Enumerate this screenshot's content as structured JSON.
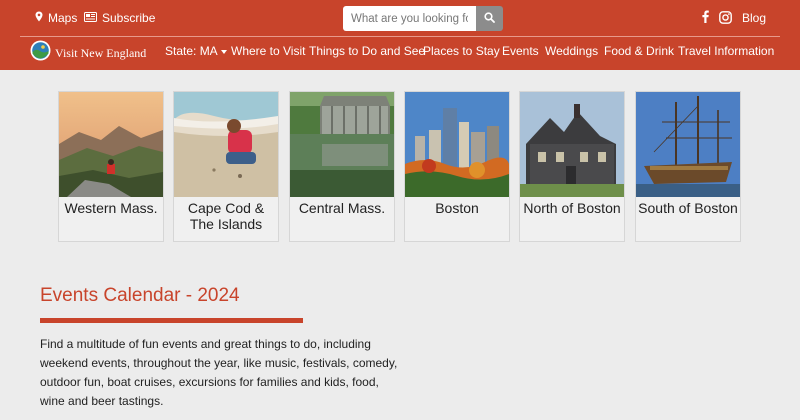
{
  "topbar": {
    "maps_label": "Maps",
    "subscribe_label": "Subscribe",
    "search_placeholder": "What are you looking for?",
    "blog_label": "Blog"
  },
  "nav": {
    "logo_text": "Visit New England",
    "items": [
      {
        "label": "State: MA"
      },
      {
        "label": "Where to Visit"
      },
      {
        "label": "Things to Do and See"
      },
      {
        "label": "Places to Stay"
      },
      {
        "label": "Events"
      },
      {
        "label": "Weddings"
      },
      {
        "label": "Food & Drink"
      },
      {
        "label": "Travel Information"
      }
    ]
  },
  "regions": [
    {
      "label": "Western Mass."
    },
    {
      "label": "Cape Cod & The Islands"
    },
    {
      "label": "Central Mass."
    },
    {
      "label": "Boston"
    },
    {
      "label": "North of Boston"
    },
    {
      "label": "South of Boston"
    }
  ],
  "events": {
    "title": "Events Calendar - 2024",
    "description": "Find a multitude of fun events and great things to do, including weekend events, throughout the year, like music, festivals, comedy, outdoor fun, boat cruises, excursions for families and kids, food, wine and beer tastings."
  },
  "colors": {
    "brand": "#c8442b",
    "page_bg": "#ececec"
  }
}
